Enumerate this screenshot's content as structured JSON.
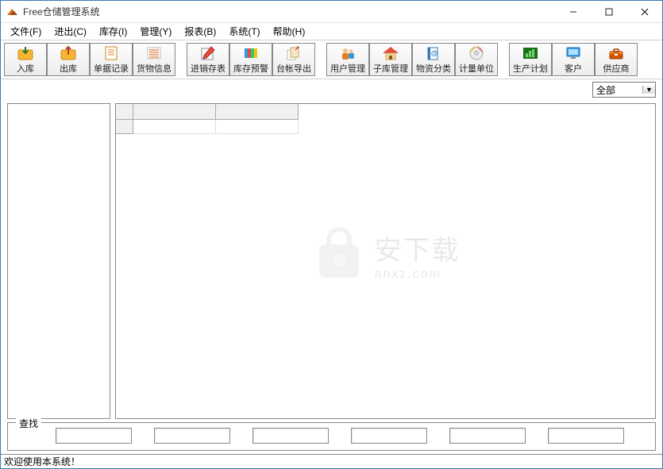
{
  "window": {
    "title": "Free仓储管理系统"
  },
  "menu": {
    "file": "文件(F)",
    "inout": "进出(C)",
    "stock": "库存(I)",
    "manage": "管理(Y)",
    "report": "报表(B)",
    "system": "系统(T)",
    "help": "帮助(H)"
  },
  "toolbar": {
    "in": "入库",
    "out": "出库",
    "records": "单据记录",
    "goods": "货物信息",
    "psi": "进销存表",
    "alert": "库存预警",
    "export": "台帐导出",
    "user": "用户管理",
    "sub": "子库管理",
    "category": "物资分类",
    "unit": "计量单位",
    "plan": "生产计划",
    "customer": "客户",
    "supplier": "供应商"
  },
  "filter": {
    "selected": "全部"
  },
  "search": {
    "legend": "查找"
  },
  "status": {
    "text": "欢迎使用本系统！"
  },
  "watermark": {
    "cn": "安下载",
    "en": "anxz.com"
  }
}
